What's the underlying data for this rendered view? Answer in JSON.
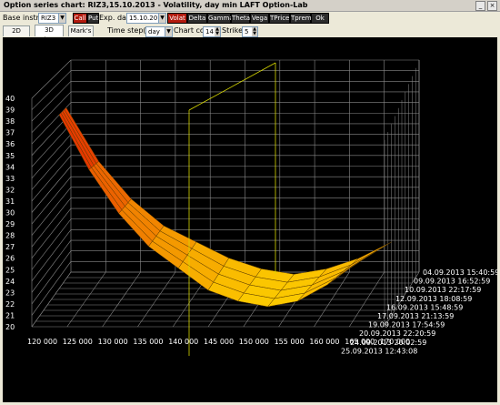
{
  "window": {
    "title": "Option series chart: RIZ3,15.10.2013 - Volatility, day min   LAFT Option-Lab",
    "min_glyph": "_",
    "close_glyph": "×"
  },
  "toolbar": {
    "base_instr_label": "Base instr:",
    "base_instr_value": "RIZ3",
    "call_label": "Call",
    "put_label": "Put",
    "exp_date_label": "Exp. date",
    "exp_date_value": "15.10.2013",
    "buttons": [
      "Volat",
      "Delta",
      "Gamma",
      "Theta",
      "Vega",
      "TPrice",
      "Tprem",
      "Ok"
    ],
    "active_button": "Volat"
  },
  "tabs": {
    "items": [
      "2D chart",
      "3D chart",
      "Mark's"
    ],
    "selected": "3D chart"
  },
  "controls": {
    "time_step_label": "Time step(min):",
    "time_step_value": "day",
    "chart_count_label": "Chart count:",
    "chart_count_value": "14",
    "strikes_label": "Strikes:",
    "strikes_value": "5"
  },
  "chart_data": {
    "type": "surface",
    "z_ticks": [
      "40",
      "39",
      "38",
      "37",
      "36",
      "35",
      "34",
      "33",
      "32",
      "31",
      "30",
      "29",
      "28",
      "27",
      "26",
      "25",
      "24",
      "23",
      "22",
      "21",
      "20"
    ],
    "strike_ticks": [
      "120 000",
      "125 000",
      "130 000",
      "135 000",
      "140 000",
      "145 000",
      "150 000",
      "155 000",
      "160 000",
      "165 000",
      "170 000"
    ],
    "date_ticks": [
      "04.09.2013 15:40:59",
      "09.09.2013 16:52:59",
      "10.09.2013 22:17:59",
      "12.09.2013 18:08:59",
      "16.09.2013 15:48:59",
      "17.09.2013 21:13:59",
      "19.09.2013 17:54:59",
      "20.09.2013 22:20:59",
      "24.09.2013 20:02:59",
      "25.09.2013 12:43:08"
    ],
    "strikes": [
      120000,
      125000,
      130000,
      135000,
      140000,
      145000,
      150000,
      155000,
      160000,
      165000,
      170000
    ],
    "volatility_surface_front": [
      38.5,
      33.5,
      29.5,
      26.5,
      24.5,
      22.5,
      21.5,
      21.0,
      21.5,
      23.0,
      25.0
    ],
    "volatility_surface_back": [
      37.0,
      32.0,
      28.5,
      26.0,
      24.5,
      23.0,
      22.0,
      21.5,
      22.0,
      23.0,
      24.5
    ],
    "zlim": [
      20,
      40
    ],
    "colors": {
      "high": "#e01500",
      "low": "#ffe000"
    }
  }
}
